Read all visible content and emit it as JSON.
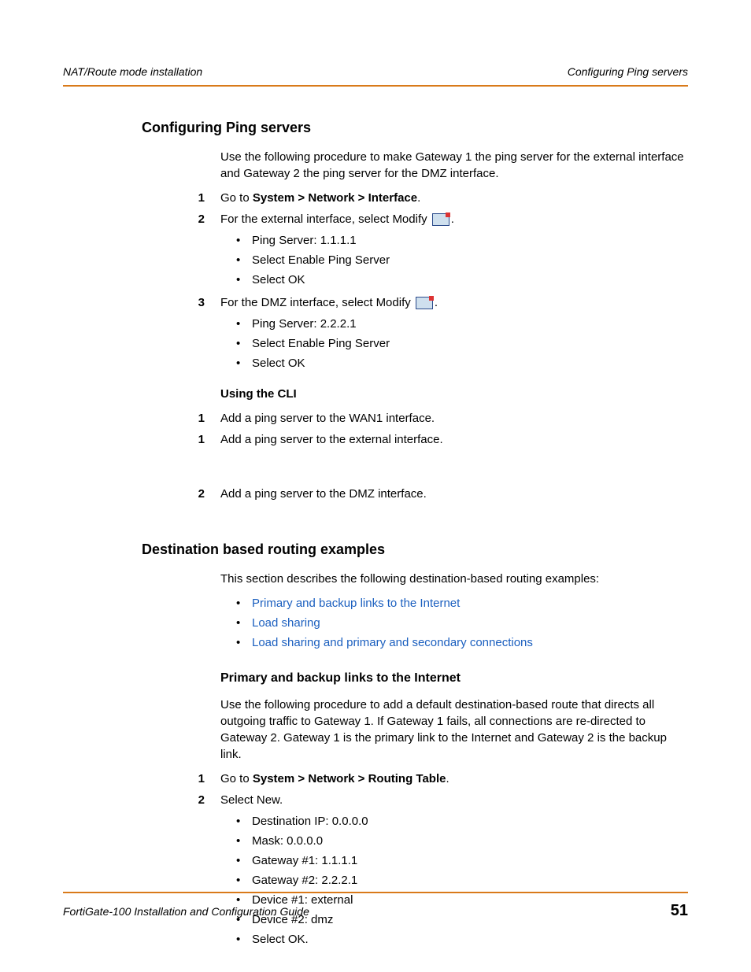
{
  "header": {
    "left": "NAT/Route mode installation",
    "right": "Configuring Ping servers"
  },
  "sections": {
    "ping": {
      "title": "Configuring Ping servers",
      "intro": "Use the following procedure to make Gateway 1 the ping server for the external interface and Gateway 2 the ping server for the DMZ interface.",
      "step1_num": "1",
      "step1_pre": "Go to ",
      "step1_bold": "System > Network > Interface",
      "step1_post": ".",
      "step2_num": "2",
      "step2_text": "For the external interface, select Modify ",
      "step2_post": ".",
      "step2_bullets": [
        "Ping Server: 1.1.1.1",
        "Select Enable Ping Server",
        "Select OK"
      ],
      "step3_num": "3",
      "step3_text": "For the DMZ interface, select Modify ",
      "step3_post": ".",
      "step3_bullets": [
        "Ping Server: 2.2.2.1",
        "Select Enable Ping Server",
        "Select OK"
      ],
      "cli_heading": "Using the CLI",
      "cli1_num": "1",
      "cli1_text": "Add a ping server to the WAN1 interface.",
      "cli2_num": "1",
      "cli2_text": "Add a ping server to the external interface.",
      "cli3_num": "2",
      "cli3_text": "Add a ping server to the DMZ interface."
    },
    "dest": {
      "title": "Destination based routing examples",
      "intro": "This section describes the following destination-based routing examples:",
      "links": [
        "Primary and backup links to the Internet",
        "Load sharing",
        "Load sharing and primary and secondary connections"
      ],
      "sub_title": "Primary and backup links to the Internet",
      "sub_intro": "Use the following procedure to add a default destination-based route that directs all outgoing traffic to Gateway 1. If Gateway 1 fails, all connections are re-directed to Gateway 2. Gateway 1 is the primary link to the Internet and Gateway 2 is the backup link.",
      "step1_num": "1",
      "step1_pre": "Go to ",
      "step1_bold": "System > Network > Routing Table",
      "step1_post": ".",
      "step2_num": "2",
      "step2_text": "Select New.",
      "step2_bullets": [
        "Destination IP: 0.0.0.0",
        "Mask: 0.0.0.0",
        "Gateway #1: 1.1.1.1",
        "Gateway #2: 2.2.2.1",
        "Device #1: external",
        "Device #2: dmz",
        "Select OK."
      ]
    }
  },
  "footer": {
    "title": "FortiGate-100 Installation and Configuration Guide",
    "page": "51"
  }
}
